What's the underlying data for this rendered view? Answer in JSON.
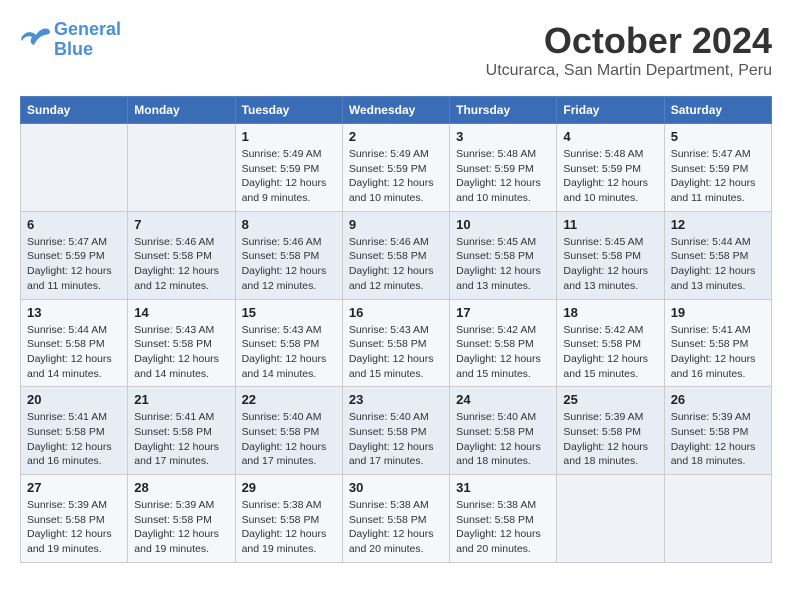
{
  "header": {
    "logo": {
      "line1": "General",
      "line2": "Blue"
    },
    "month": "October 2024",
    "location": "Utcurarca, San Martin Department, Peru"
  },
  "weekdays": [
    "Sunday",
    "Monday",
    "Tuesday",
    "Wednesday",
    "Thursday",
    "Friday",
    "Saturday"
  ],
  "weeks": [
    [
      {
        "day": null
      },
      {
        "day": null
      },
      {
        "day": "1",
        "sunrise": "5:49 AM",
        "sunset": "5:59 PM",
        "daylight": "12 hours and 9 minutes."
      },
      {
        "day": "2",
        "sunrise": "5:49 AM",
        "sunset": "5:59 PM",
        "daylight": "12 hours and 10 minutes."
      },
      {
        "day": "3",
        "sunrise": "5:48 AM",
        "sunset": "5:59 PM",
        "daylight": "12 hours and 10 minutes."
      },
      {
        "day": "4",
        "sunrise": "5:48 AM",
        "sunset": "5:59 PM",
        "daylight": "12 hours and 10 minutes."
      },
      {
        "day": "5",
        "sunrise": "5:47 AM",
        "sunset": "5:59 PM",
        "daylight": "12 hours and 11 minutes."
      }
    ],
    [
      {
        "day": "6",
        "sunrise": "5:47 AM",
        "sunset": "5:59 PM",
        "daylight": "12 hours and 11 minutes."
      },
      {
        "day": "7",
        "sunrise": "5:46 AM",
        "sunset": "5:58 PM",
        "daylight": "12 hours and 12 minutes."
      },
      {
        "day": "8",
        "sunrise": "5:46 AM",
        "sunset": "5:58 PM",
        "daylight": "12 hours and 12 minutes."
      },
      {
        "day": "9",
        "sunrise": "5:46 AM",
        "sunset": "5:58 PM",
        "daylight": "12 hours and 12 minutes."
      },
      {
        "day": "10",
        "sunrise": "5:45 AM",
        "sunset": "5:58 PM",
        "daylight": "12 hours and 13 minutes."
      },
      {
        "day": "11",
        "sunrise": "5:45 AM",
        "sunset": "5:58 PM",
        "daylight": "12 hours and 13 minutes."
      },
      {
        "day": "12",
        "sunrise": "5:44 AM",
        "sunset": "5:58 PM",
        "daylight": "12 hours and 13 minutes."
      }
    ],
    [
      {
        "day": "13",
        "sunrise": "5:44 AM",
        "sunset": "5:58 PM",
        "daylight": "12 hours and 14 minutes."
      },
      {
        "day": "14",
        "sunrise": "5:43 AM",
        "sunset": "5:58 PM",
        "daylight": "12 hours and 14 minutes."
      },
      {
        "day": "15",
        "sunrise": "5:43 AM",
        "sunset": "5:58 PM",
        "daylight": "12 hours and 14 minutes."
      },
      {
        "day": "16",
        "sunrise": "5:43 AM",
        "sunset": "5:58 PM",
        "daylight": "12 hours and 15 minutes."
      },
      {
        "day": "17",
        "sunrise": "5:42 AM",
        "sunset": "5:58 PM",
        "daylight": "12 hours and 15 minutes."
      },
      {
        "day": "18",
        "sunrise": "5:42 AM",
        "sunset": "5:58 PM",
        "daylight": "12 hours and 15 minutes."
      },
      {
        "day": "19",
        "sunrise": "5:41 AM",
        "sunset": "5:58 PM",
        "daylight": "12 hours and 16 minutes."
      }
    ],
    [
      {
        "day": "20",
        "sunrise": "5:41 AM",
        "sunset": "5:58 PM",
        "daylight": "12 hours and 16 minutes."
      },
      {
        "day": "21",
        "sunrise": "5:41 AM",
        "sunset": "5:58 PM",
        "daylight": "12 hours and 17 minutes."
      },
      {
        "day": "22",
        "sunrise": "5:40 AM",
        "sunset": "5:58 PM",
        "daylight": "12 hours and 17 minutes."
      },
      {
        "day": "23",
        "sunrise": "5:40 AM",
        "sunset": "5:58 PM",
        "daylight": "12 hours and 17 minutes."
      },
      {
        "day": "24",
        "sunrise": "5:40 AM",
        "sunset": "5:58 PM",
        "daylight": "12 hours and 18 minutes."
      },
      {
        "day": "25",
        "sunrise": "5:39 AM",
        "sunset": "5:58 PM",
        "daylight": "12 hours and 18 minutes."
      },
      {
        "day": "26",
        "sunrise": "5:39 AM",
        "sunset": "5:58 PM",
        "daylight": "12 hours and 18 minutes."
      }
    ],
    [
      {
        "day": "27",
        "sunrise": "5:39 AM",
        "sunset": "5:58 PM",
        "daylight": "12 hours and 19 minutes."
      },
      {
        "day": "28",
        "sunrise": "5:39 AM",
        "sunset": "5:58 PM",
        "daylight": "12 hours and 19 minutes."
      },
      {
        "day": "29",
        "sunrise": "5:38 AM",
        "sunset": "5:58 PM",
        "daylight": "12 hours and 19 minutes."
      },
      {
        "day": "30",
        "sunrise": "5:38 AM",
        "sunset": "5:58 PM",
        "daylight": "12 hours and 20 minutes."
      },
      {
        "day": "31",
        "sunrise": "5:38 AM",
        "sunset": "5:58 PM",
        "daylight": "12 hours and 20 minutes."
      },
      {
        "day": null
      },
      {
        "day": null
      }
    ]
  ],
  "labels": {
    "sunrise_prefix": "Sunrise:",
    "sunset_prefix": "Sunset:",
    "daylight_prefix": "Daylight:"
  }
}
